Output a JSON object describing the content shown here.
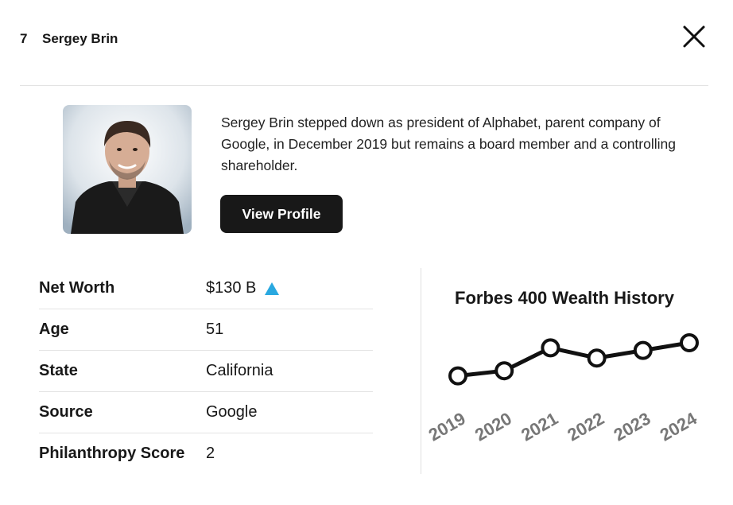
{
  "header": {
    "rank": "7",
    "name": "Sergey Brin"
  },
  "profile": {
    "description": "Sergey Brin stepped down as president of Alphabet, parent company of Google, in December 2019 but remains a board member and a controlling shareholder.",
    "button_label": "View Profile"
  },
  "stats": [
    {
      "label": "Net Worth",
      "value": "$130 B"
    },
    {
      "label": "Age",
      "value": "51"
    },
    {
      "label": "State",
      "value": "California"
    },
    {
      "label": "Source",
      "value": "Google"
    },
    {
      "label": "Philanthropy Score",
      "value": "2"
    }
  ],
  "trend": {
    "direction": "up",
    "color": "#29a8e0"
  },
  "icons": {
    "close": "close-icon",
    "trend": "triangle-up-icon"
  },
  "chart_data": {
    "type": "line",
    "title": "Forbes 400 Wealth History",
    "x": [
      "2019",
      "2020",
      "2021",
      "2022",
      "2023",
      "2024"
    ],
    "values": [
      62,
      64,
      73,
      69,
      72,
      75
    ],
    "ylim": [
      55,
      80
    ],
    "grid": false,
    "legend": "none",
    "color": "#111111"
  }
}
